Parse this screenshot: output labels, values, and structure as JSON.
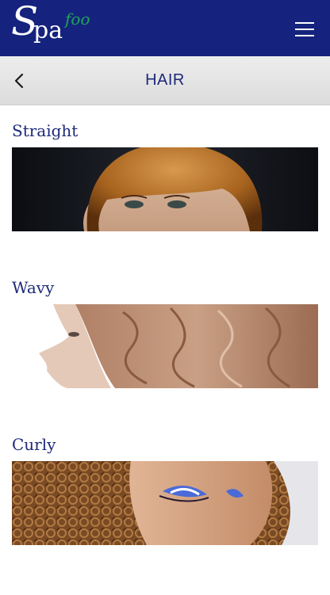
{
  "header": {
    "logo": {
      "s": "S",
      "pa": "pa",
      "foo": "foo"
    },
    "menu_icon": "hamburger-icon"
  },
  "titlebar": {
    "back_icon": "chevron-left-icon",
    "title": "HAIR"
  },
  "categories": [
    {
      "title": "Straight"
    },
    {
      "title": "Wavy"
    },
    {
      "title": "Curly"
    }
  ],
  "colors": {
    "header_bg": "#15237e",
    "title_text": "#1e2a78",
    "logo_accent": "#1fa35a"
  }
}
